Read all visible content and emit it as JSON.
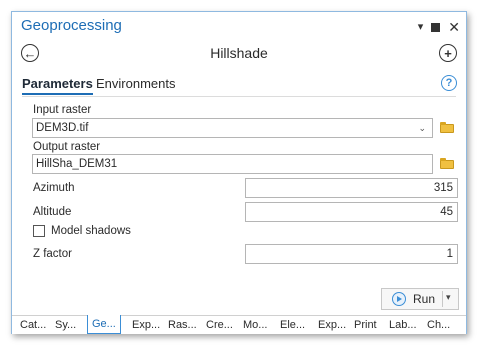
{
  "window": {
    "title": "Geoprocessing"
  },
  "nav": {
    "tool_title": "Hillshade",
    "back_symbol": "←",
    "add_symbol": "+"
  },
  "tabs": [
    {
      "label": "Parameters"
    },
    {
      "label": "Environments"
    }
  ],
  "params": {
    "input_raster": {
      "label": "Input raster",
      "value": "DEM3D.tif"
    },
    "output_raster": {
      "label": "Output raster",
      "value": "HillSha_DEM31"
    },
    "azimuth": {
      "label": "Azimuth",
      "value": "315"
    },
    "altitude": {
      "label": "Altitude",
      "value": "45"
    },
    "model_shadows": {
      "label": "Model shadows",
      "checked": false
    },
    "z_factor": {
      "label": "Z factor",
      "value": "1"
    }
  },
  "run": {
    "label": "Run"
  },
  "bottom_tabs": [
    "Cat...",
    "Sy...",
    "Ge...",
    "Exp...",
    "Ras...",
    "Cre...",
    "Mo...",
    "Ele...",
    "Exp...",
    "Print",
    "Lab...",
    "Ch..."
  ],
  "icons": {
    "collapse": "chevron-down-icon",
    "pin": "pin-icon",
    "close": "close-icon",
    "back": "back-arrow-icon",
    "add": "add-icon",
    "help": "help-icon",
    "folder": "folder-icon",
    "run": "run-icon"
  },
  "colors": {
    "accent": "#1d6db5",
    "border": "#8fb9e0",
    "folder": "#f0c040"
  }
}
